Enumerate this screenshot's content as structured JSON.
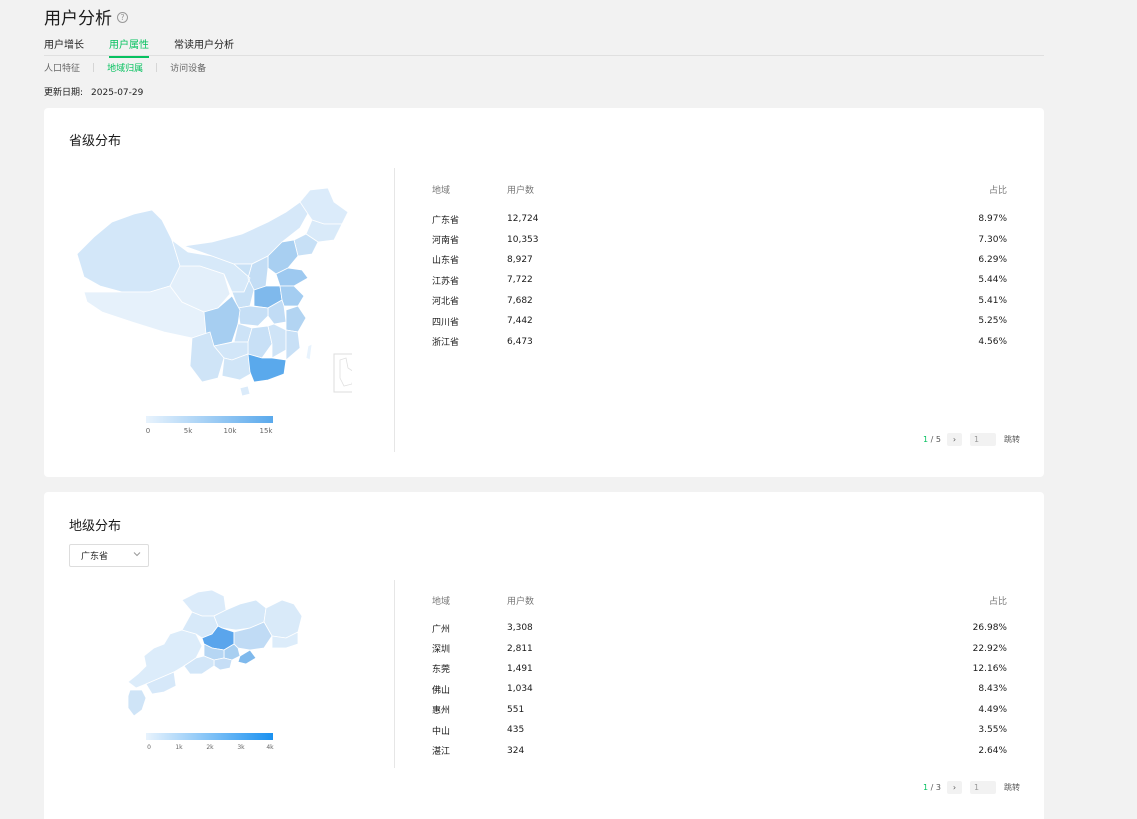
{
  "page": {
    "title": "用户分析",
    "help_icon": "help-circle-icon"
  },
  "tabs": [
    {
      "label": "用户增长",
      "active": false
    },
    {
      "label": "用户属性",
      "active": true
    },
    {
      "label": "常读用户分析",
      "active": false
    }
  ],
  "subtabs": [
    {
      "label": "人口特征",
      "active": false
    },
    {
      "label": "地域归属",
      "active": true
    },
    {
      "label": "访问设备",
      "active": false
    }
  ],
  "update": {
    "label": "更新日期:",
    "date": "2025-07-29"
  },
  "province": {
    "title": "省级分布",
    "legend": [
      "0",
      "5k",
      "10k",
      "15k"
    ],
    "columns": {
      "region": "地域",
      "users": "用户数",
      "ratio": "占比"
    },
    "rows": [
      {
        "region": "广东省",
        "users": "12,724",
        "ratio": "8.97%"
      },
      {
        "region": "河南省",
        "users": "10,353",
        "ratio": "7.30%"
      },
      {
        "region": "山东省",
        "users": "8,927",
        "ratio": "6.29%"
      },
      {
        "region": "江苏省",
        "users": "7,722",
        "ratio": "5.44%"
      },
      {
        "region": "河北省",
        "users": "7,682",
        "ratio": "5.41%"
      },
      {
        "region": "四川省",
        "users": "7,442",
        "ratio": "5.25%"
      },
      {
        "region": "浙江省",
        "users": "6,473",
        "ratio": "4.56%"
      }
    ],
    "pager": {
      "current": "1",
      "total": "/ 5",
      "input": "1",
      "jump": "跳转"
    }
  },
  "city": {
    "title": "地级分布",
    "select_value": "广东省",
    "legend": [
      "0",
      "1k",
      "2k",
      "3k",
      "4k"
    ],
    "columns": {
      "region": "地域",
      "users": "用户数",
      "ratio": "占比"
    },
    "rows": [
      {
        "region": "广州",
        "users": "3,308",
        "ratio": "26.98%"
      },
      {
        "region": "深圳",
        "users": "2,811",
        "ratio": "22.92%"
      },
      {
        "region": "东莞",
        "users": "1,491",
        "ratio": "12.16%"
      },
      {
        "region": "佛山",
        "users": "1,034",
        "ratio": "8.43%"
      },
      {
        "region": "惠州",
        "users": "551",
        "ratio": "4.49%"
      },
      {
        "region": "中山",
        "users": "435",
        "ratio": "3.55%"
      },
      {
        "region": "湛江",
        "users": "324",
        "ratio": "2.64%"
      }
    ],
    "pager": {
      "current": "1",
      "total": "/ 3",
      "input": "1",
      "jump": "跳转"
    }
  },
  "colors": {
    "accent": "#07c160",
    "map_low": "#e8f3fd",
    "map_high": "#5aa9ec",
    "city_high": "#1a91f0"
  }
}
